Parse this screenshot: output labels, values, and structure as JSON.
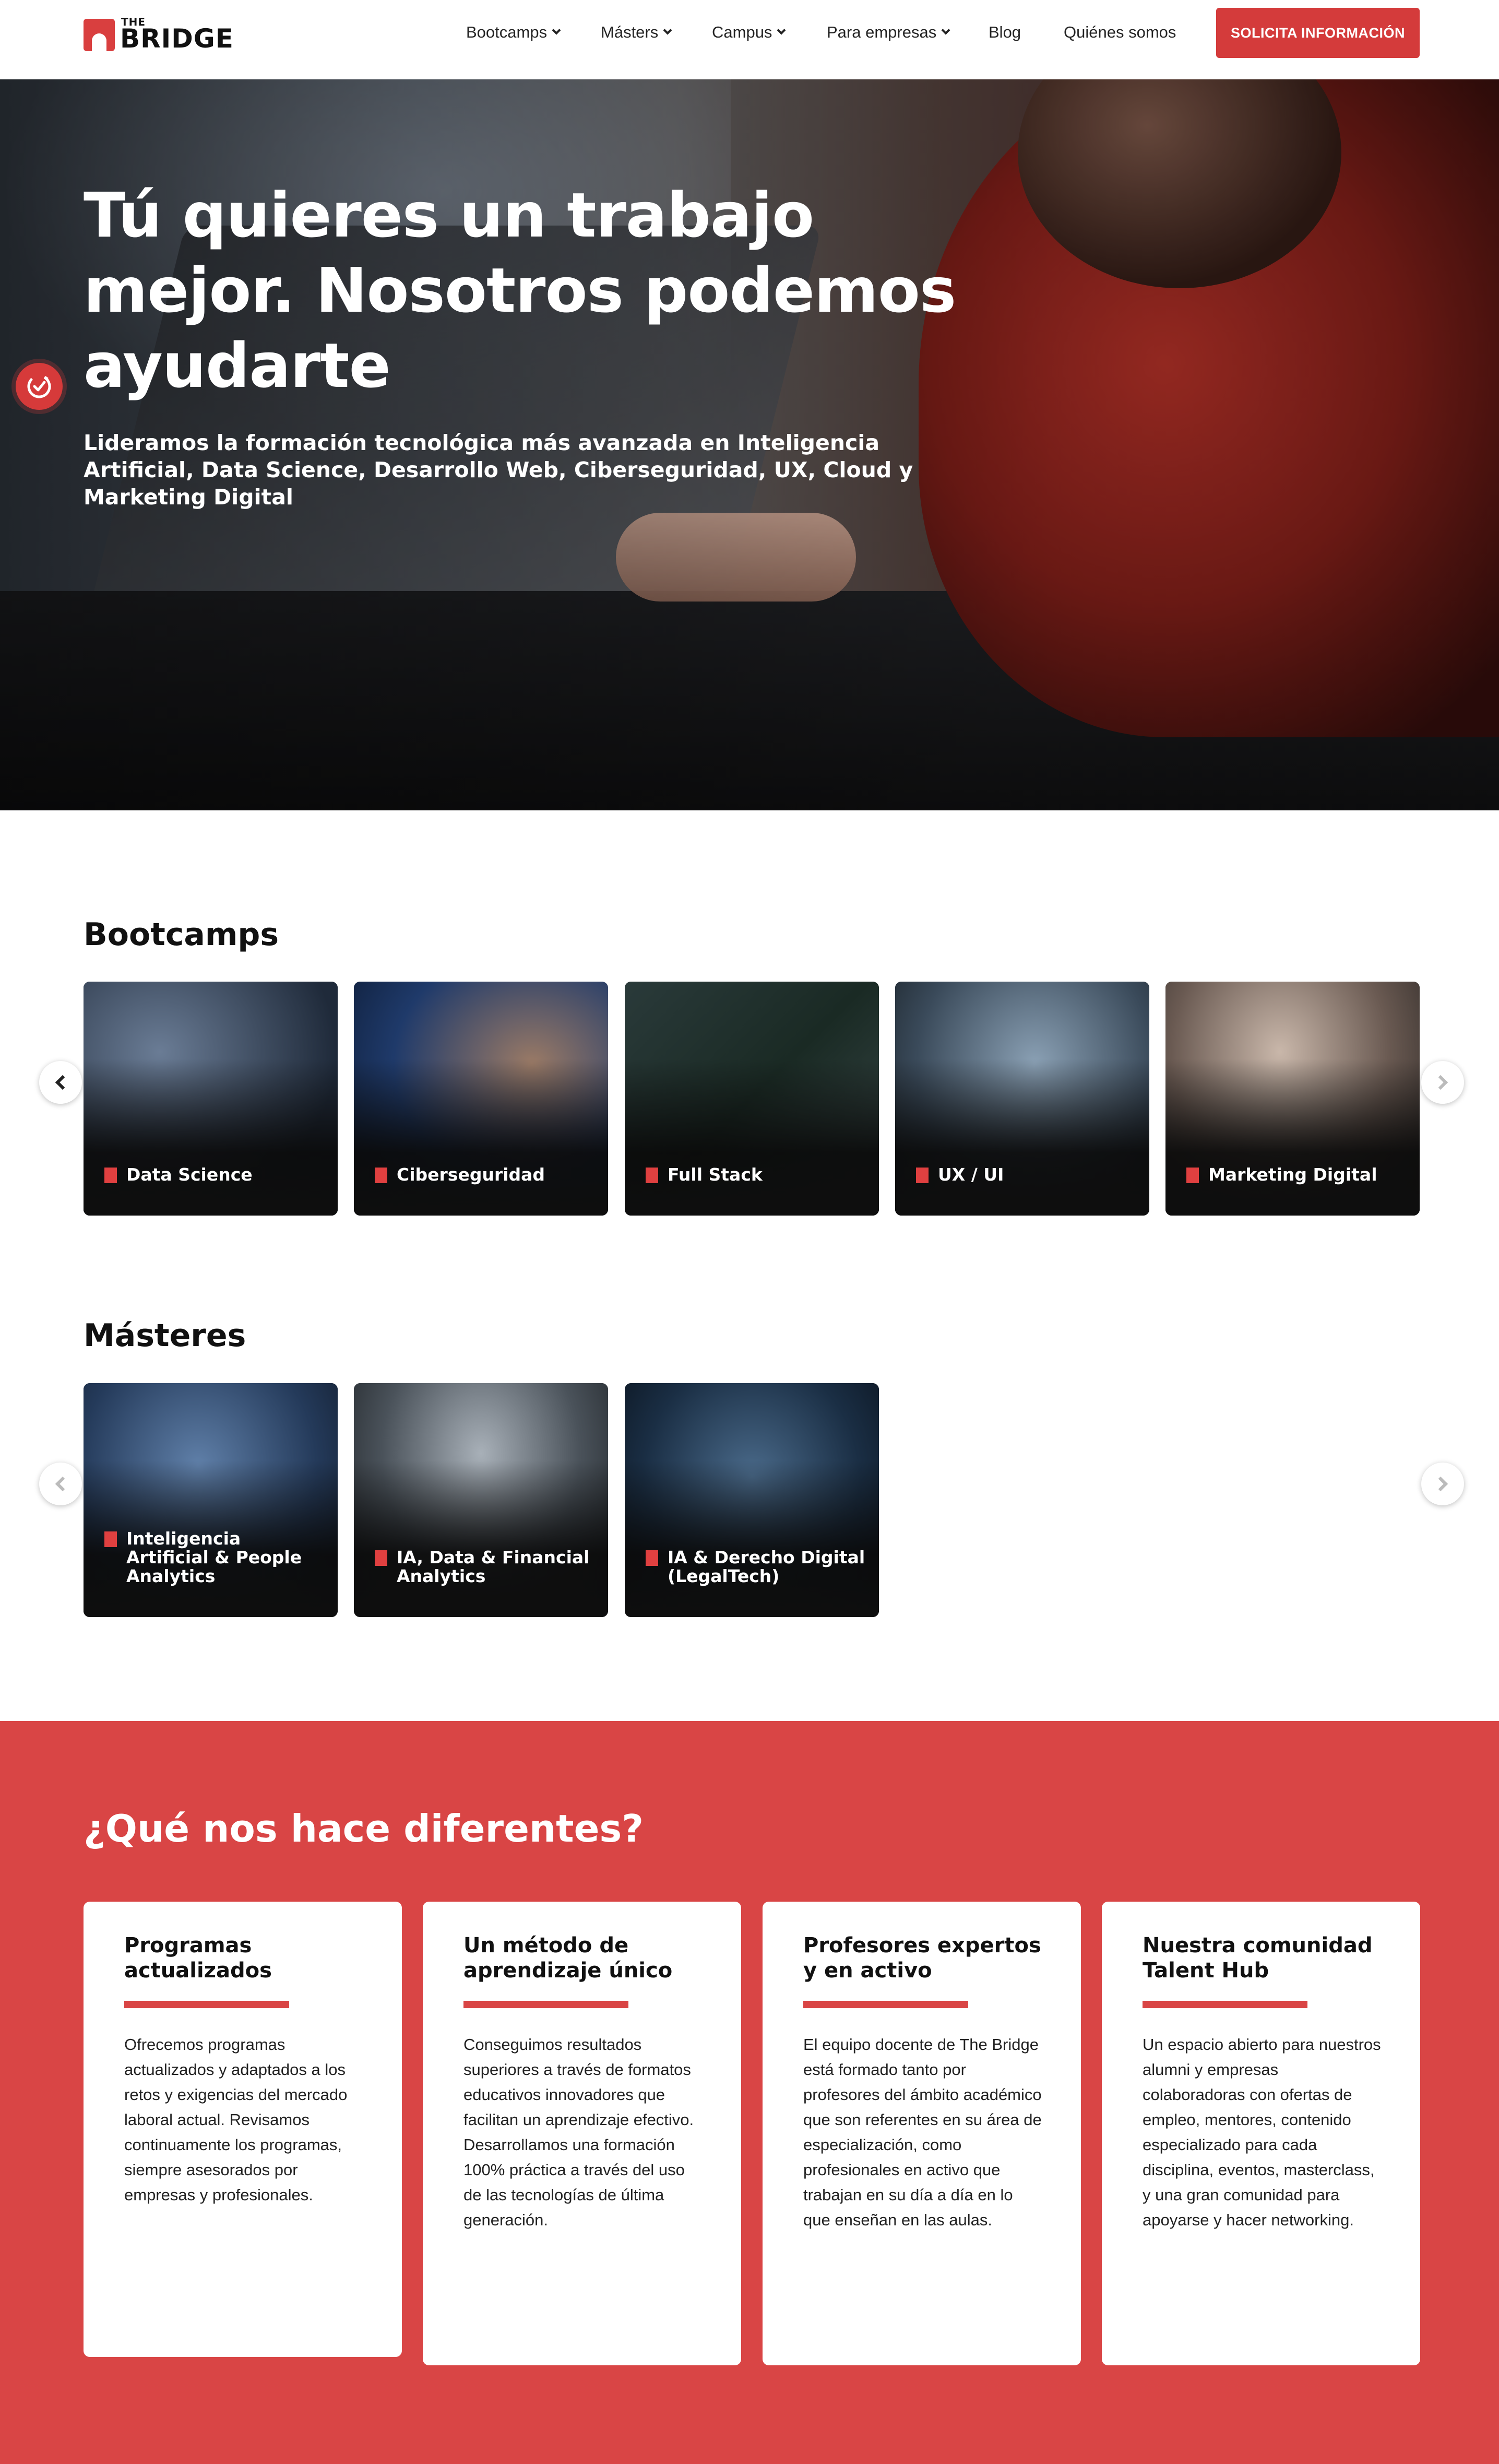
{
  "header": {
    "logo_top": "THE",
    "logo_main": "BRIDGE",
    "nav": [
      {
        "label": "Bootcamps",
        "has_dropdown": true
      },
      {
        "label": "Másters",
        "has_dropdown": true
      },
      {
        "label": "Campus",
        "has_dropdown": true
      },
      {
        "label": "Para empresas",
        "has_dropdown": true
      },
      {
        "label": "Blog",
        "has_dropdown": false
      },
      {
        "label": "Quiénes somos",
        "has_dropdown": false
      }
    ],
    "cta_label": "SOLICITA INFORMACIÓN"
  },
  "hero": {
    "title": "Tú quieres un trabajo mejor. Nosotros podemos ayudarte",
    "subtitle": "Lideramos la formación tecnológica más avanzada en Inteligencia Artificial, Data Science, Desarrollo Web, Ciberseguridad, UX, Cloud y Marketing Digital",
    "badge_icon": "accessibility-clock-icon"
  },
  "bootcamps": {
    "title": "Bootcamps",
    "items": [
      {
        "label": "Data Science"
      },
      {
        "label": "Ciberseguridad"
      },
      {
        "label": "Full Stack"
      },
      {
        "label": "UX / UI"
      },
      {
        "label": "Marketing Digital"
      }
    ]
  },
  "masters": {
    "title": "Másteres",
    "items": [
      {
        "label": "Inteligencia Artificial & People Analytics"
      },
      {
        "label": "IA, Data & Financial Analytics"
      },
      {
        "label": "IA & Derecho Digital (LegalTech)"
      }
    ]
  },
  "differences": {
    "title": "¿Qué nos hace diferentes?",
    "items": [
      {
        "title": "Programas actualizados",
        "text": "Ofrecemos programas actualizados y adaptados a los retos y exigencias del mercado laboral actual. Revisamos continuamente los programas, siempre asesorados por empresas y profesionales."
      },
      {
        "title": "Un método de aprendizaje único",
        "text": "Conseguimos resultados superiores a través de formatos educativos innovadores que facilitan un aprendizaje efectivo. Desarrollamos una formación 100% práctica a través del uso de las tecnologías de última generación."
      },
      {
        "title": "Profesores expertos y en activo",
        "text": "El equipo docente de The Bridge está formado tanto por profesores del ámbito académico que son referentes en su área de especialización, como profesionales en activo que trabajan en su día a día en lo que enseñan en las aulas."
      },
      {
        "title": "Nuestra comunidad Talent Hub",
        "text": "Un espacio abierto para nuestros alumni y empresas colaboradoras con ofertas de empleo, mentores, contenido especializado para cada disciplina, eventos, masterclass, y una gran comunidad para apoyarse y hacer networking."
      }
    ]
  },
  "colors": {
    "brand_red": "#d94545",
    "cta_red": "#d43b3b",
    "card_marker": "#e04040"
  }
}
